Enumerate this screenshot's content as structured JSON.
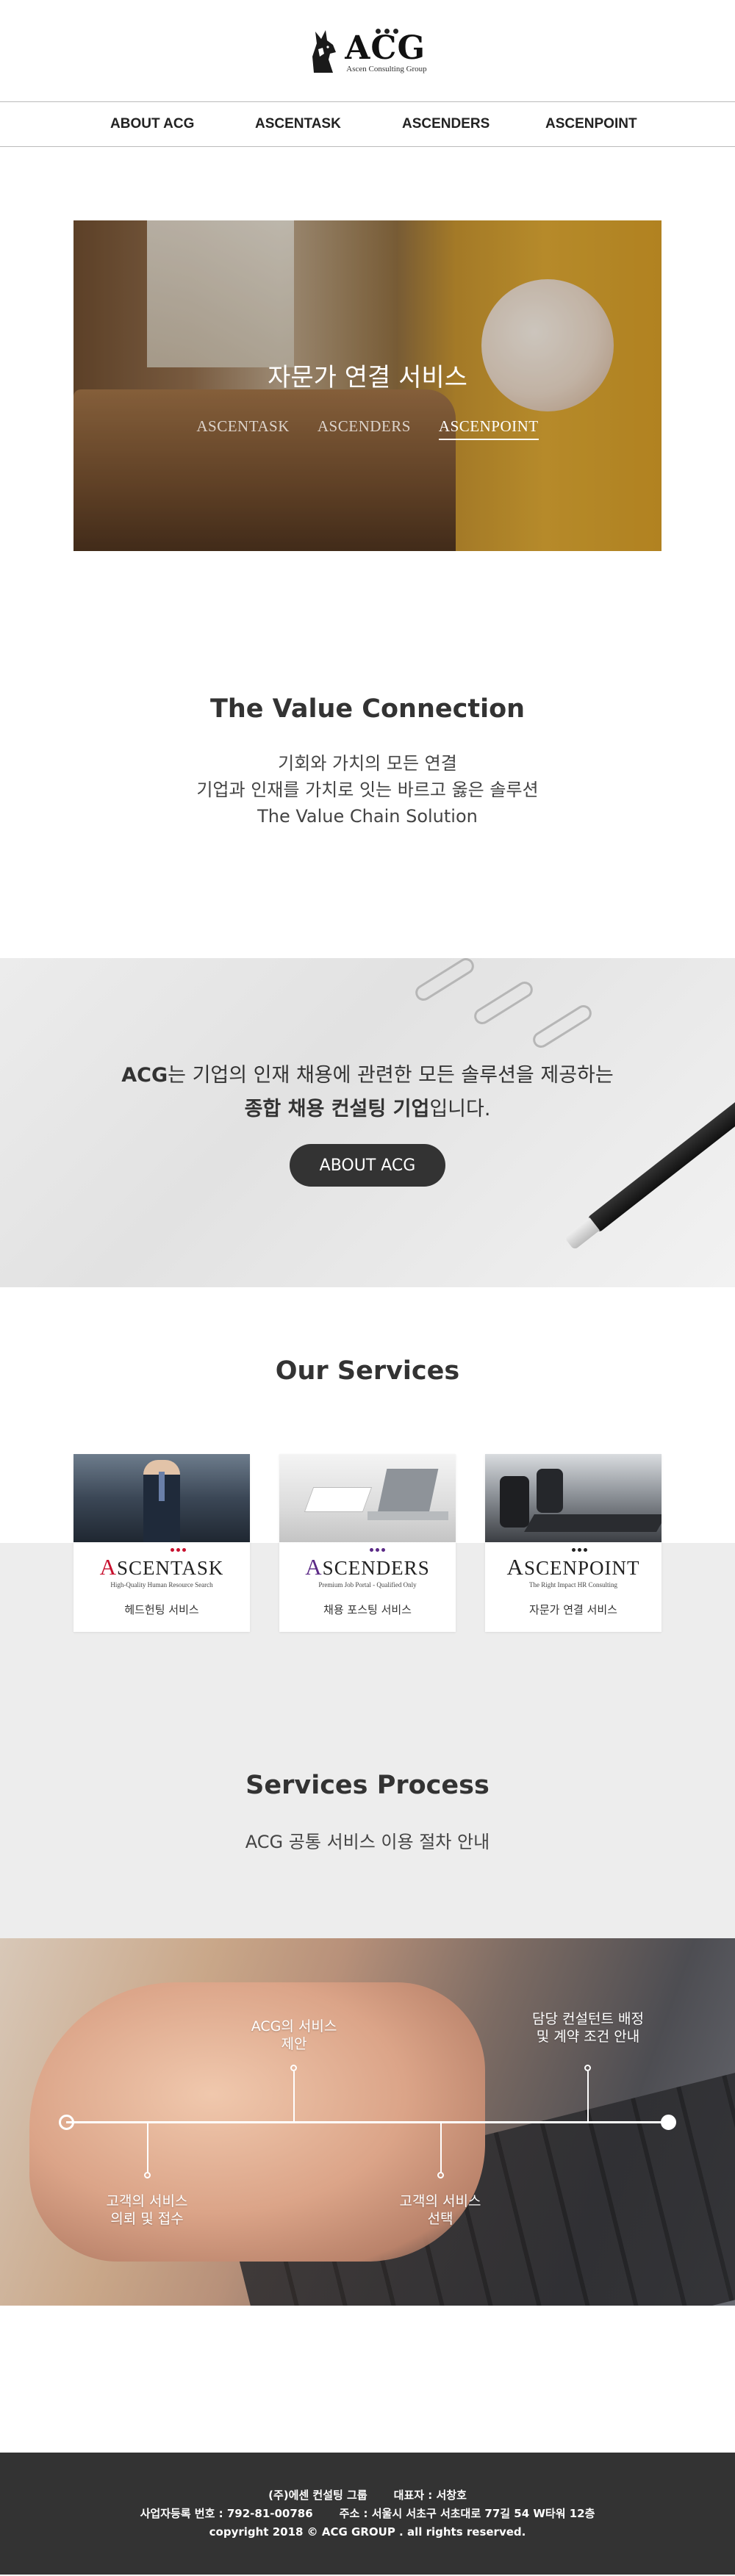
{
  "brand": {
    "name": "ACG",
    "subtitle": "Ascen Consulting Group"
  },
  "nav": [
    {
      "label": "ABOUT ACG"
    },
    {
      "label": "ASCENTASK"
    },
    {
      "label": "ASCENDERS"
    },
    {
      "label": "ASCENPOINT"
    }
  ],
  "hero": {
    "title": "자문가 연결 서비스",
    "tabs": [
      {
        "label": "ASCENTASK",
        "active": false
      },
      {
        "label": "ASCENDERS",
        "active": false
      },
      {
        "label": "ASCENPOINT",
        "active": true
      }
    ]
  },
  "value": {
    "title": "The Value Connection",
    "lines": [
      "기회와 가치의 모든 연결",
      "기업과 인재를 가치로 잇는 바르고 옳은 솔루션",
      "The Value Chain Solution"
    ]
  },
  "about": {
    "line1_bold": "ACG",
    "line1_rest": "는 기업의 인재 채용에 관련한 모든 솔루션을 제공하는",
    "line2_bold": "종합 채용 컨설팅 기업",
    "line2_rest": "입니다.",
    "button": "ABOUT ACG"
  },
  "services": {
    "title": "Our Services",
    "cards": [
      {
        "first": "A",
        "rest": "SCENTASK",
        "tagline": "High-Quality Human Resource Search",
        "desc": "헤드헌팅 서비스",
        "accent": "#c8102e"
      },
      {
        "first": "A",
        "rest": "SCENDERS",
        "tagline": "Premium Job Portal - Qualified Only",
        "desc": "채용 포스팅 서비스",
        "accent": "#5b2a86"
      },
      {
        "first": "A",
        "rest": "SCENPOINT",
        "tagline": "The Right Impact HR Consulting",
        "desc": "자문가 연결 서비스",
        "accent": "#222222"
      }
    ]
  },
  "process": {
    "title": "Services Process",
    "subtitle": "ACG 공통 서비스 이용 절차 안내",
    "steps": [
      {
        "line1": "고객의 서비스",
        "line2": "의뢰 및 접수"
      },
      {
        "line1": "ACG의 서비스",
        "line2": "제안"
      },
      {
        "line1": "고객의 서비스",
        "line2": "선택"
      },
      {
        "line1": "담당 컨설턴트 배정",
        "line2": "및 계약 조건 안내"
      }
    ]
  },
  "footer": {
    "company": "(주)에센 컨설팅 그룹",
    "ceo": "대표자 : 서창호",
    "biz_no": "사업자등록 번호 : 792-81-00786",
    "address": "주소 : 서울시 서초구 서초대로 77길 54 W타워 12층",
    "copyright": "copyright 2018 © ACG GROUP . all rights reserved."
  },
  "colors": {
    "dark": "#333333",
    "light_band": "#ededed",
    "ascentask_accent": "#c8102e",
    "ascenders_accent": "#5b2a86"
  },
  "icons": {
    "logo_mark": "wolf-logo-icon"
  }
}
